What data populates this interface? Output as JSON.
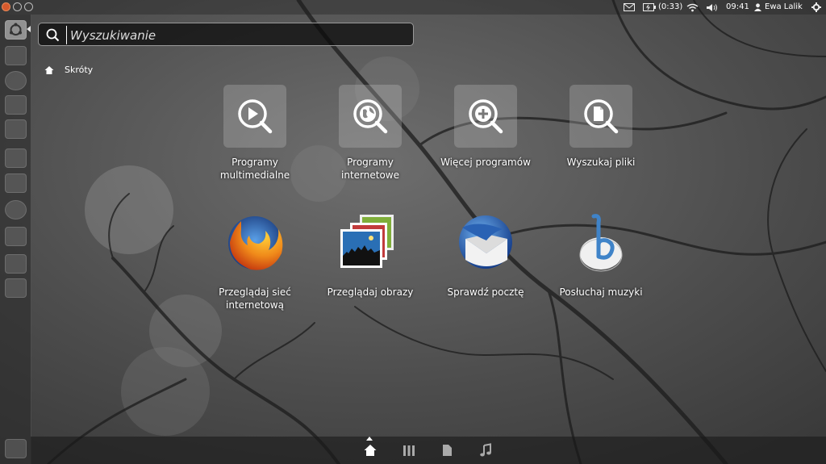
{
  "top_panel": {
    "battery": "(0:33)",
    "clock": "09:41",
    "user": "Ewa Lalik"
  },
  "search": {
    "placeholder": "Wyszukiwanie"
  },
  "breadcrumb": {
    "label": "Skróty"
  },
  "tiles_row1": [
    {
      "line1": "Programy",
      "line2": "multimedialne",
      "icon": "play-search-icon"
    },
    {
      "line1": "Programy",
      "line2": "internetowe",
      "icon": "globe-search-icon"
    },
    {
      "line1": "Więcej programów",
      "line2": "",
      "icon": "plus-search-icon"
    },
    {
      "line1": "Wyszukaj pliki",
      "line2": "",
      "icon": "file-search-icon"
    }
  ],
  "tiles_row2": [
    {
      "line1": "Przeglądaj sieć",
      "line2": "internetową",
      "icon": "firefox-icon"
    },
    {
      "line1": "Przeglądaj obrazy",
      "line2": "",
      "icon": "photos-icon"
    },
    {
      "line1": "Sprawdź pocztę",
      "line2": "",
      "icon": "thunderbird-icon"
    },
    {
      "line1": "Posłuchaj muzyki",
      "line2": "",
      "icon": "banshee-icon"
    }
  ],
  "bottom_lenses": [
    "home-lens-icon",
    "applications-lens-icon",
    "files-lens-icon",
    "music-lens-icon"
  ],
  "colors": {
    "firefox_orange": "#e8751a",
    "firefox_blue": "#2d5fa8",
    "thunderbird_blue": "#2a62b4",
    "banshee_blue": "#3f83c8"
  }
}
